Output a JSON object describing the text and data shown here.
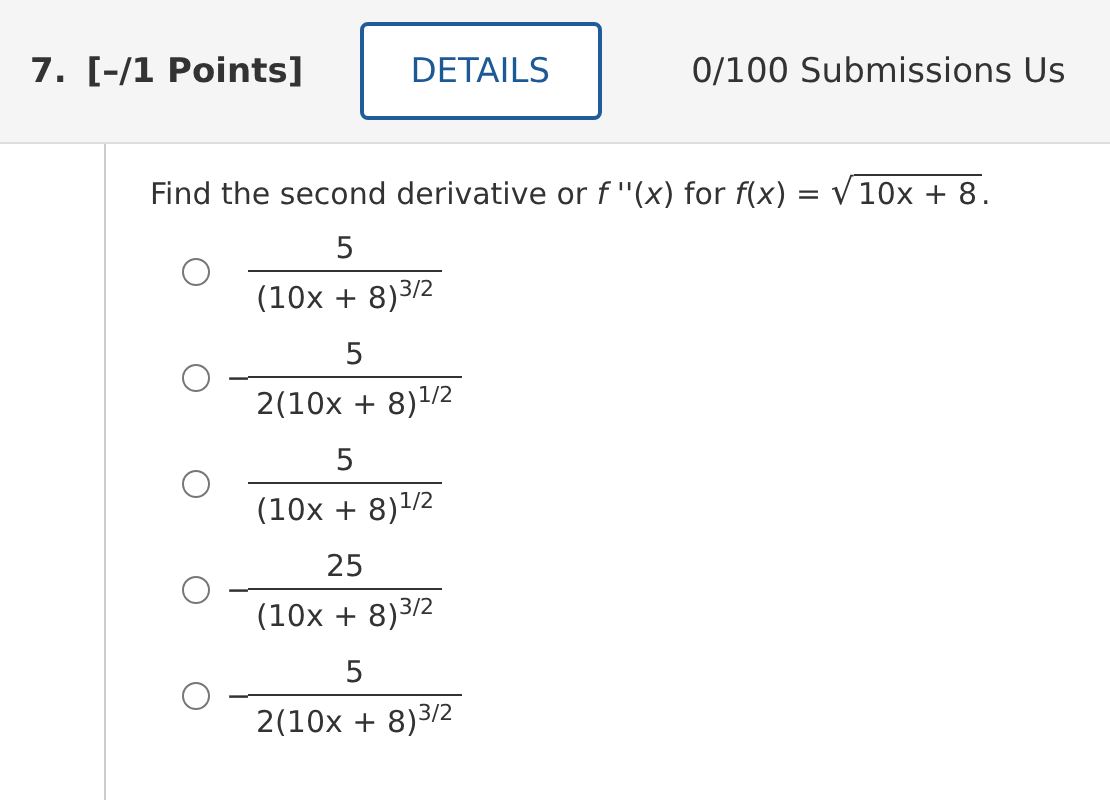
{
  "header": {
    "number": "7.",
    "points": "[–/1 Points]",
    "details_button": "DETAILS",
    "submissions": "0/100 Submissions Us"
  },
  "question": {
    "text": "Find the second derivative or *f* ''(*x*) for *f*(*x*) = ",
    "radical_sign": "√",
    "radicand": "10x + 8",
    "end": "."
  },
  "options": [
    {
      "numerator": "5",
      "denominator": "(10x + 8)$^{3/2}$",
      "selected": false
    },
    {
      "sign": "−",
      "numerator": "5",
      "denominator": "2(10x + 8)$^{1/2}$",
      "selected": false
    },
    {
      "numerator": "5",
      "denominator": "(10x + 8)$^{1/2}$",
      "selected": false
    },
    {
      "sign": "−",
      "numerator": "25",
      "denominator": "(10x + 8)$^{3/2}$",
      "selected": false
    },
    {
      "sign": "−",
      "numerator": "5",
      "denominator": "2(10x + 8)$^{3/2}$",
      "selected": false
    }
  ]
}
